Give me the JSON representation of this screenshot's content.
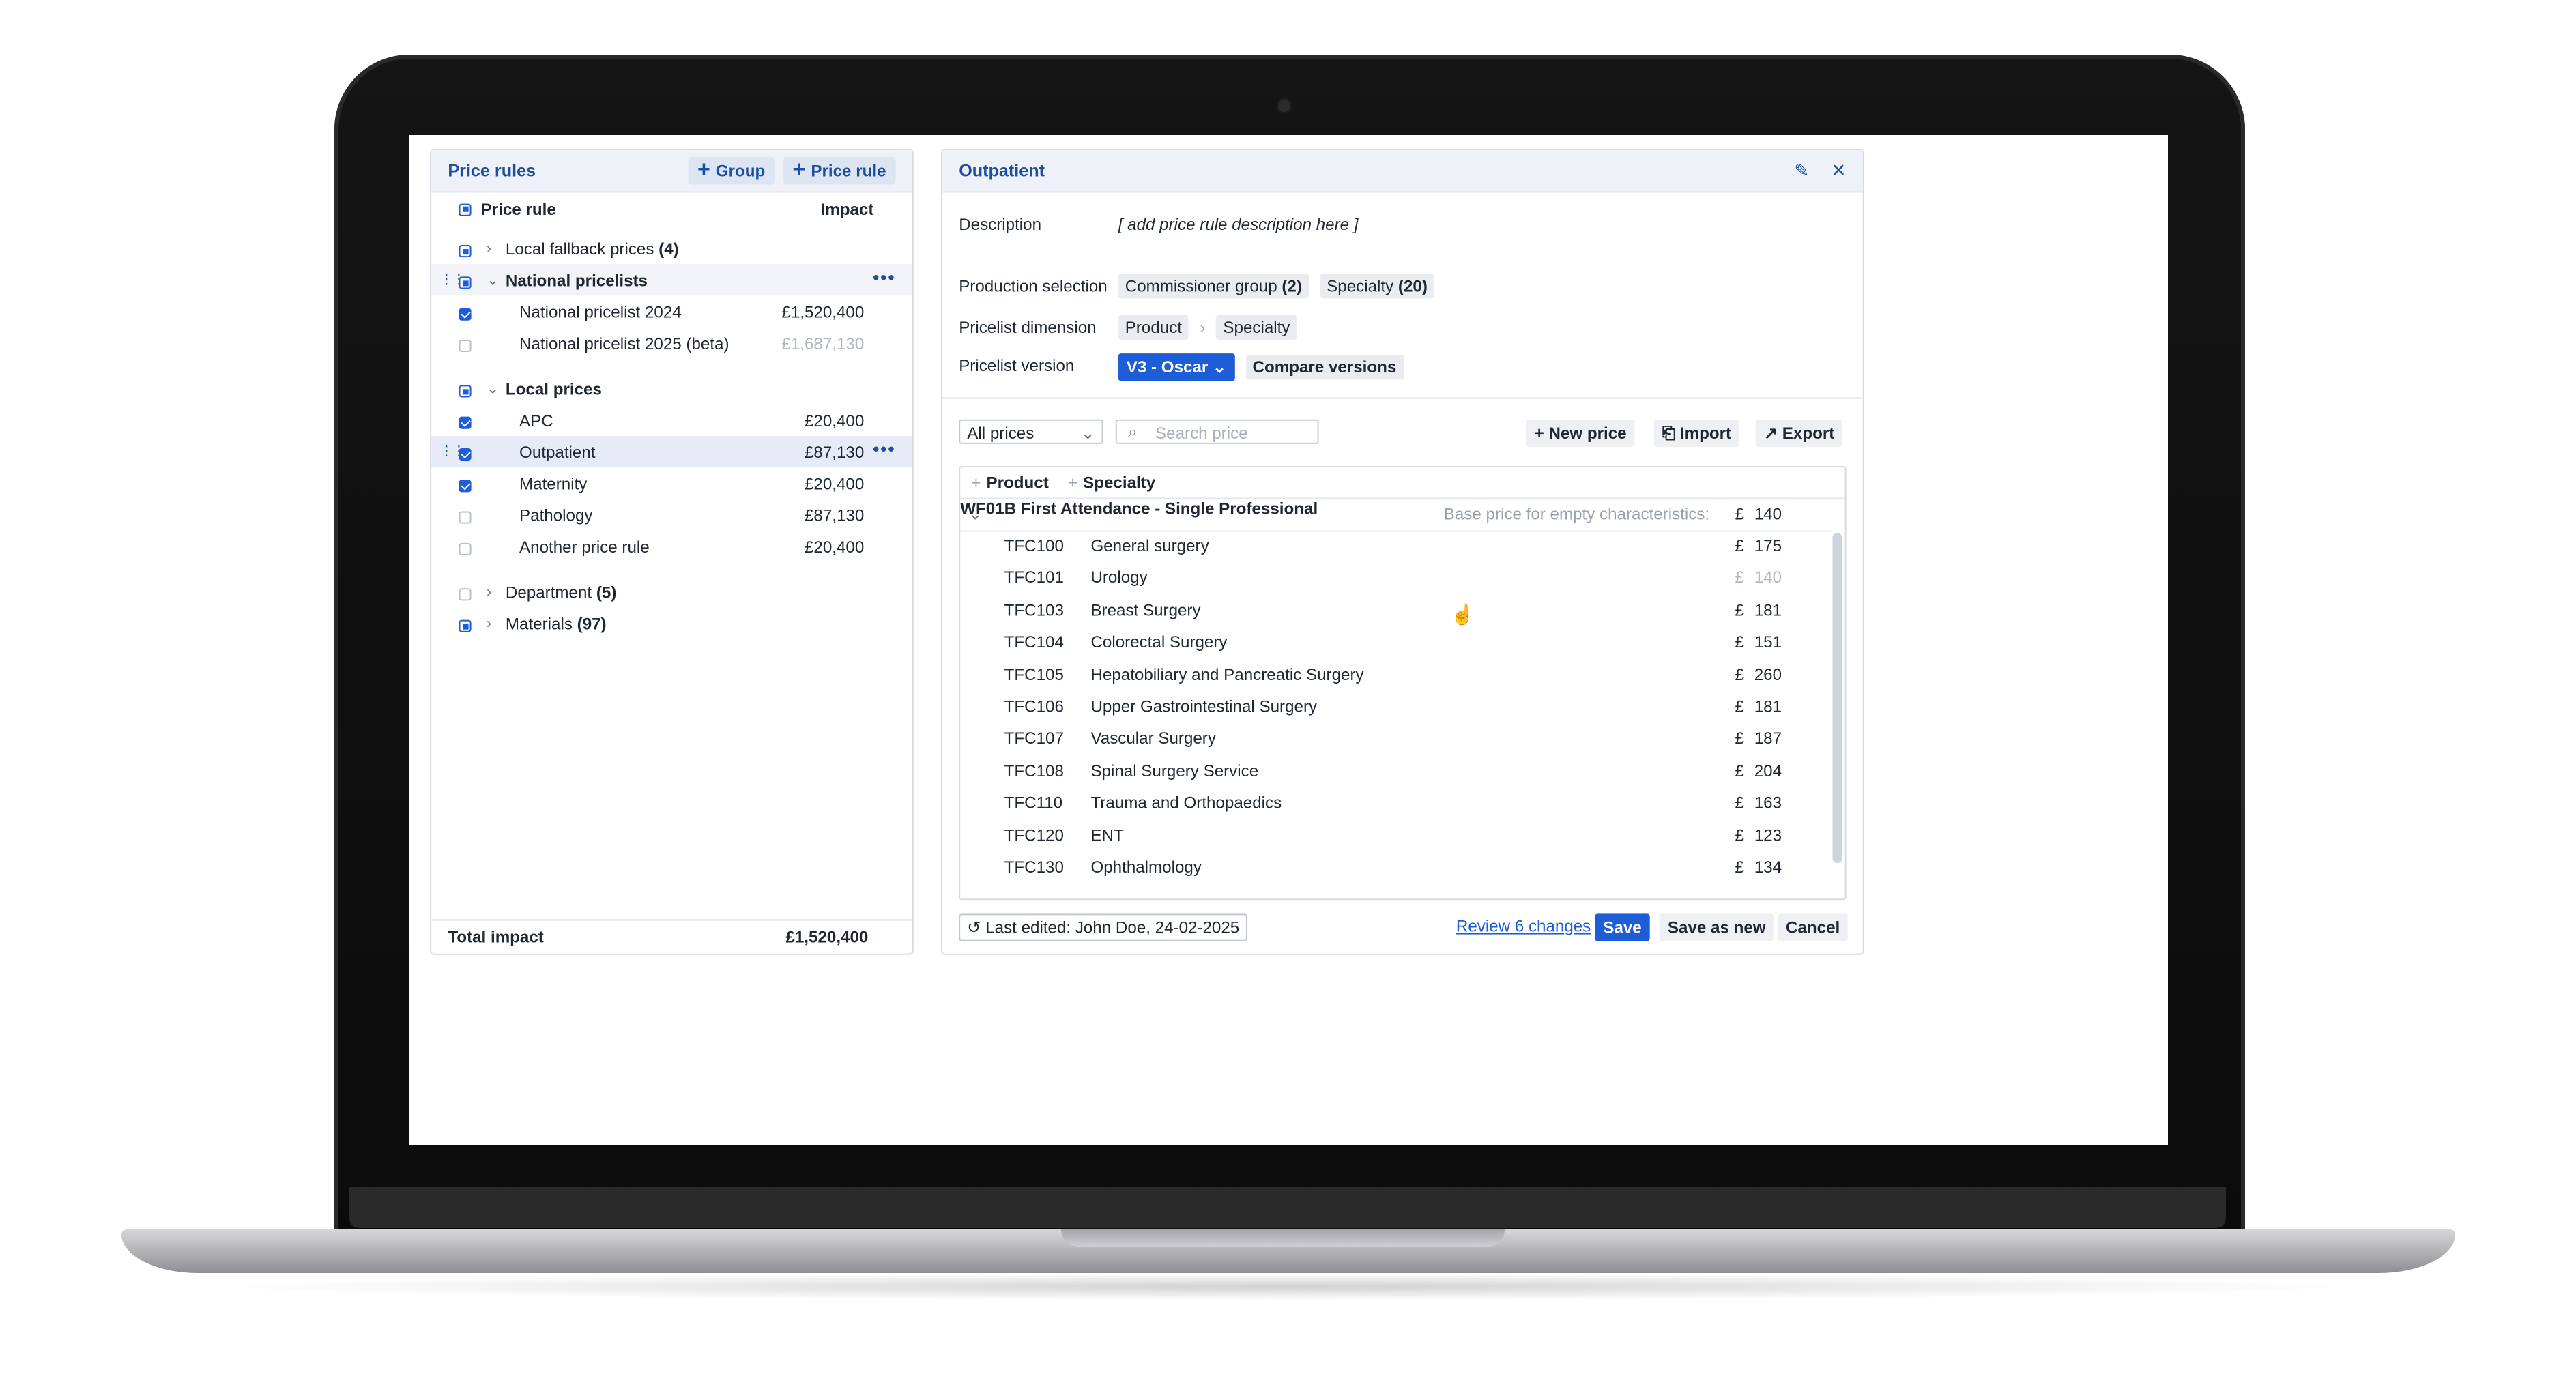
{
  "left": {
    "title": "Price rules",
    "group_btn": "Group",
    "rule_btn": "Price rule",
    "col_rule": "Price rule",
    "col_impact": "Impact",
    "rows": [
      {
        "label": "Local fallback prices",
        "count": "(4)",
        "value": ""
      },
      {
        "label": "National pricelists",
        "value": ""
      },
      {
        "label": "National pricelist 2024",
        "value": "£1,520,400"
      },
      {
        "label": "National pricelist 2025 (beta)",
        "value": "£1,687,130"
      },
      {
        "label": "Local prices",
        "value": ""
      },
      {
        "label": "APC",
        "value": "£20,400"
      },
      {
        "label": "Outpatient",
        "value": "£87,130"
      },
      {
        "label": "Maternity",
        "value": "£20,400"
      },
      {
        "label": "Pathology",
        "value": "£87,130"
      },
      {
        "label": "Another price rule",
        "value": "£20,400"
      },
      {
        "label": "Department",
        "count": "(5)",
        "value": ""
      },
      {
        "label": "Materials",
        "count": "(97)",
        "value": ""
      }
    ],
    "total_label": "Total impact",
    "total_value": "£1,520,400"
  },
  "right": {
    "title": "Outpatient",
    "desc_label": "Description",
    "desc_value": "[ add price rule description here ]",
    "prod_label": "Production selection",
    "chip1": "Commissioner group",
    "chip1_count": "(2)",
    "chip2": "Specialty",
    "chip2_count": "(20)",
    "dim_label": "Pricelist dimension",
    "dim1": "Product",
    "dim2": "Specialty",
    "ver_label": "Pricelist version",
    "ver_value": "V3 - Oscar",
    "compare": "Compare versions",
    "filter": "All prices",
    "search_placeholder": "Search price",
    "new_price": "New price",
    "import": "Import",
    "export": "Export",
    "gh_product": "Product",
    "gh_specialty": "Specialty",
    "group_code": "WF01B",
    "group_name": "First Attendance - Single Professional",
    "base_label": "Base price for empty characteristics:",
    "currency": "£",
    "base_value": "140",
    "items": [
      {
        "code": "TFC100",
        "name": "General surgery",
        "price": "175"
      },
      {
        "code": "TFC101",
        "name": "Urology",
        "price": "140"
      },
      {
        "code": "TFC103",
        "name": "Breast Surgery",
        "price": "181"
      },
      {
        "code": "TFC104",
        "name": "Colorectal Surgery",
        "price": "151"
      },
      {
        "code": "TFC105",
        "name": "Hepatobiliary  and  Pancreatic Surgery",
        "price": "260"
      },
      {
        "code": "TFC106",
        "name": "Upper Gastrointestinal Surgery",
        "price": "181"
      },
      {
        "code": "TFC107",
        "name": "Vascular Surgery",
        "price": "187"
      },
      {
        "code": "TFC108",
        "name": "Spinal Surgery Service",
        "price": "204"
      },
      {
        "code": "TFC110",
        "name": "Trauma  and  Orthopaedics",
        "price": "163"
      },
      {
        "code": "TFC120",
        "name": "ENT",
        "price": "123"
      },
      {
        "code": "TFC130",
        "name": "Ophthalmology",
        "price": "134"
      }
    ],
    "last_edited": "Last edited: John Doe, 24-02-2025",
    "review": "Review 6 changes",
    "save": "Save",
    "save_new": "Save as new",
    "cancel": "Cancel"
  }
}
